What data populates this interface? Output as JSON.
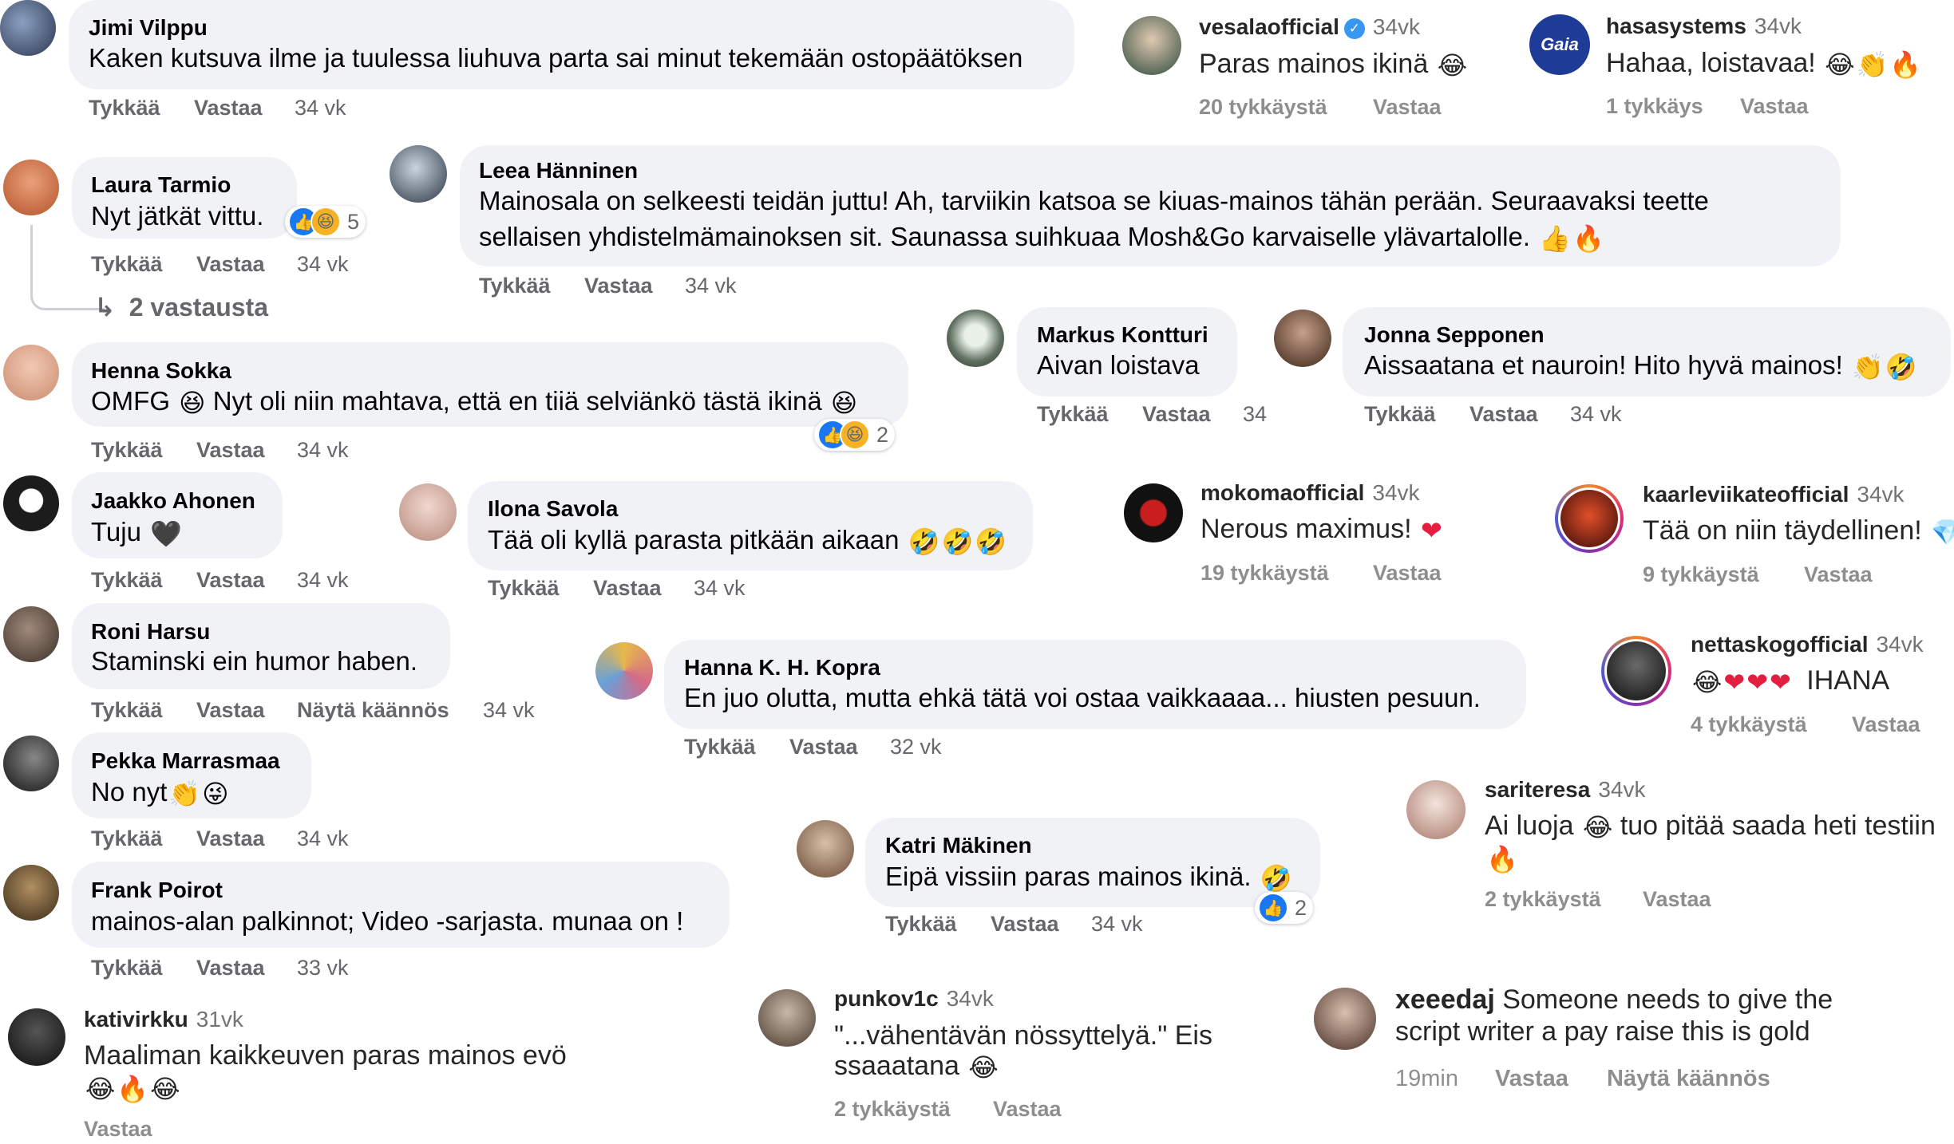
{
  "actions": {
    "like": "Tykkää",
    "reply": "Vastaa",
    "translate": "Näytä käännös"
  },
  "fb_comments": {
    "jimi": {
      "name": "Jimi Vilppu",
      "text": "Kaken kutsuva ilme ja tuulessa liuhuva parta sai minut tekemään ostopäätöksen",
      "time": "34 vk"
    },
    "laura": {
      "name": "Laura Tarmio",
      "text": "Nyt jätkät vittu.",
      "time": "34 vk",
      "reactions": "5",
      "replies": "2 vastausta"
    },
    "leea": {
      "name": "Leea Hänninen",
      "line1": "Mainosala on selkeesti teidän juttu! Ah, tarviikin katsoa se kiuas-mainos tähän perään. Seuraavaksi teette",
      "line2": "sellaisen yhdistelmämainoksen sit. Saunassa suihkuaa Mosh&Go karvaiselle ylävartalolle.",
      "time": "34 vk"
    },
    "markus": {
      "name": "Markus Kontturi",
      "text": "Aivan loistava",
      "time": "34"
    },
    "jonna": {
      "name": "Jonna Sepponen",
      "text": "Aissaatana et nauroin! Hito hyvä mainos!",
      "time": "34 vk"
    },
    "henna": {
      "name": "Henna Sokka",
      "text_a": "OMFG",
      "text_b": "Nyt oli niin mahtava, että en tiiä selviänkö tästä ikinä",
      "time": "34 vk",
      "reactions": "2"
    },
    "jaakko": {
      "name": "Jaakko Ahonen",
      "text": "Tuju",
      "time": "34 vk"
    },
    "ilona": {
      "name": "Ilona Savola",
      "text": "Tää oli kyllä parasta pitkään aikaan",
      "time": "34 vk"
    },
    "roni": {
      "name": "Roni Harsu",
      "text": "Staminski ein humor haben.",
      "time": "34 vk"
    },
    "hanna": {
      "name": "Hanna K. H. Kopra",
      "text": "En juo olutta, mutta ehkä tätä voi ostaa vaikkaaaa... hiusten pesuun.",
      "time": "32 vk"
    },
    "pekka": {
      "name": "Pekka Marrasmaa",
      "text": "No nyt",
      "time": "34 vk"
    },
    "katri": {
      "name": "Katri Mäkinen",
      "text": "Eipä vissiin paras mainos ikinä.",
      "time": "34 vk",
      "reactions": "2"
    },
    "frank": {
      "name": "Frank Poirot",
      "text": "mainos-alan palkinnot; Video -sarjasta. munaa on !",
      "time": "33 vk"
    }
  },
  "ig_comments": {
    "vesala": {
      "user": "vesalaofficial",
      "time": "34vk",
      "text": "Paras mainos ikinä",
      "likes": "20 tykkäystä"
    },
    "hasa": {
      "user": "hasasystems",
      "time": "34vk",
      "text": "Hahaa, loistavaa!",
      "likes": "1 tykkäys",
      "logo": "Gaia"
    },
    "mokoma": {
      "user": "mokomaofficial",
      "time": "34vk",
      "text": "Nerous maximus!",
      "likes": "19 tykkäystä"
    },
    "kaarle": {
      "user": "kaarleviikateofficial",
      "time": "34vk",
      "text": "Tää on niin täydellinen!",
      "likes": "9 tykkäystä"
    },
    "nettas": {
      "user": "nettaskogofficial",
      "time": "34vk",
      "text": "IHANA",
      "likes": "4 tykkäystä"
    },
    "sari": {
      "user": "sariteresa",
      "time": "34vk",
      "text_a": "Ai luoja",
      "text_b": "tuo pitää saada heti testiin",
      "likes": "2 tykkäystä"
    },
    "kati": {
      "user": "kativirkku",
      "time": "31vk",
      "text": "Maaliman kaikkeuven paras mainos evö"
    },
    "punk": {
      "user": "punkov1c",
      "time": "34vk",
      "line1": "\"...vähentävän nössyttelyä.\" Eis",
      "line2": "ssaaatana",
      "likes": "2 tykkäystä"
    },
    "xee": {
      "user": "xeeedaj",
      "line1": "Someone needs to give the",
      "line2": "script writer a pay raise this is gold",
      "time": "19min"
    }
  },
  "colors": {
    "bubble": "#f0f2f5",
    "meta": "#65676b",
    "like_blue": "#1877f2",
    "verified": "#3897f0"
  },
  "icons": [
    "reply-arrow-icon",
    "like-reaction-icon",
    "haha-reaction-icon",
    "verified-badge-icon"
  ]
}
